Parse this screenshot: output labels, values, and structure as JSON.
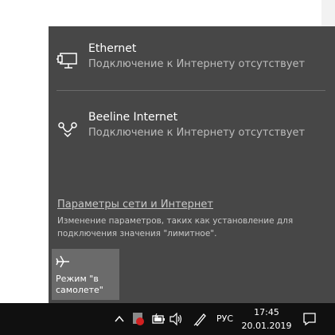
{
  "networks": [
    {
      "name": "Ethernet",
      "status": "Подключение к Интернету отсутствует",
      "icon": "ethernet-icon"
    },
    {
      "name": "Beeline Internet",
      "status": "Подключение к Интернету отсутствует",
      "icon": "dialup-icon"
    }
  ],
  "settings": {
    "link": "Параметры сети и Интернет",
    "description": "Изменение параметров, таких как установление для подключения значения \"лимитное\"."
  },
  "quick_actions": [
    {
      "label": "Режим \"в самолете\"",
      "icon": "airplane-icon"
    }
  ],
  "taskbar": {
    "language": "РУС",
    "time": "17:45",
    "date": "20.01.2019",
    "tray_icons": [
      "chevron-up-icon",
      "antivirus-icon",
      "battery-icon",
      "volume-icon",
      "pen-icon",
      "action-center-icon"
    ]
  },
  "colors": {
    "flyout_bg": "#474747",
    "tile_bg": "#6b6b6b",
    "taskbar_bg": "#101010"
  }
}
